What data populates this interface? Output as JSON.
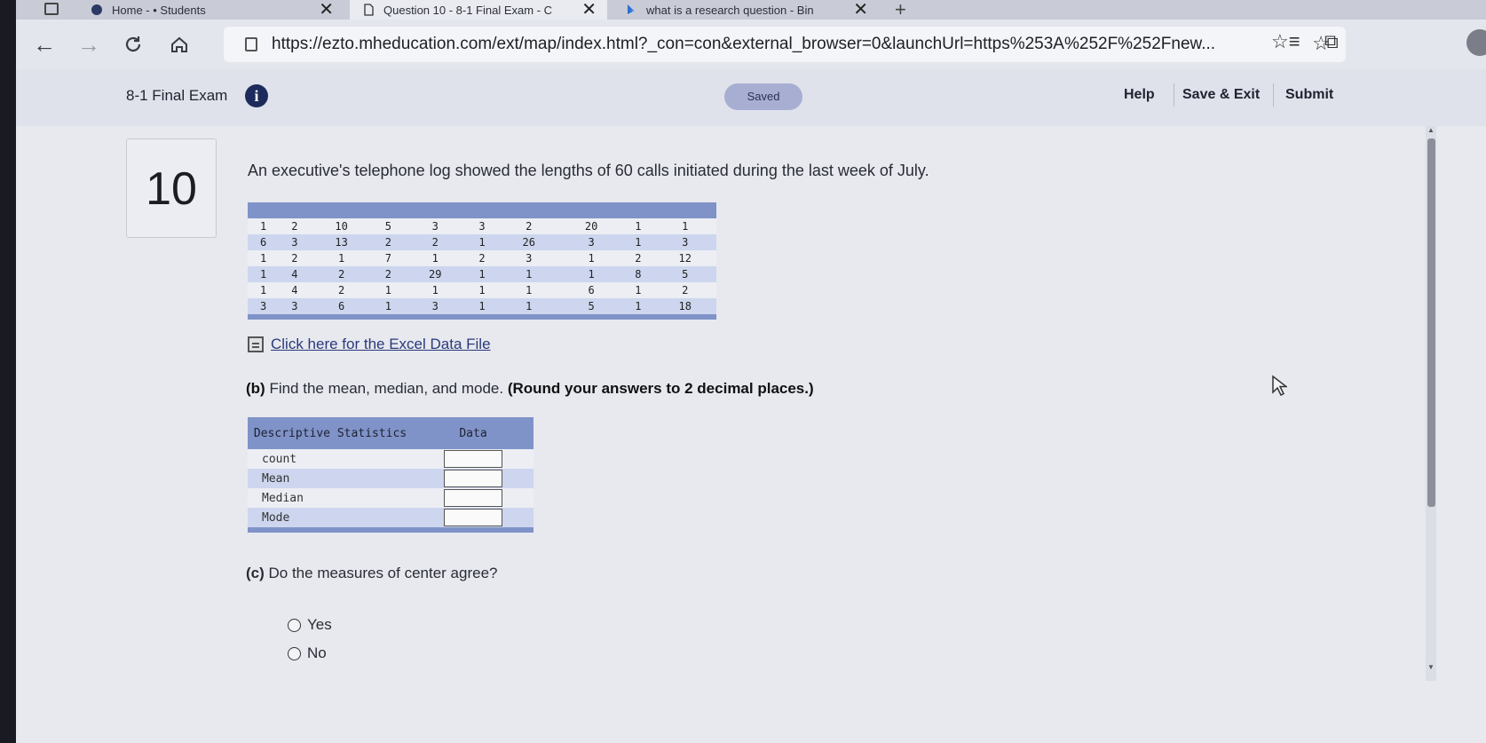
{
  "browser": {
    "tabs": [
      {
        "label": "Home - • Students"
      },
      {
        "label": "Question 10 - 8-1 Final Exam - C",
        "active": true
      },
      {
        "label": "what is a research question - Bin"
      }
    ],
    "url": "https://ezto.mheducation.com/ext/map/index.html?_con=con&external_browser=0&launchUrl=https%253A%252F%252Fnew..."
  },
  "header": {
    "exam_title": "8-1 Final Exam",
    "saved_label": "Saved",
    "help_label": "Help",
    "save_exit_label": "Save & Exit",
    "submit_label": "Submit"
  },
  "question": {
    "number": "10",
    "prompt": "An executive's telephone log showed the lengths of 60 calls initiated during the last week of July.",
    "data_rows": [
      [
        "1",
        "2",
        "10",
        "5",
        "3",
        "3",
        "2",
        "20",
        "1",
        "1"
      ],
      [
        "6",
        "3",
        "13",
        "2",
        "2",
        "1",
        "26",
        "3",
        "1",
        "3"
      ],
      [
        "1",
        "2",
        "1",
        "7",
        "1",
        "2",
        "3",
        "1",
        "2",
        "12"
      ],
      [
        "1",
        "4",
        "2",
        "2",
        "29",
        "1",
        "1",
        "1",
        "8",
        "5"
      ],
      [
        "1",
        "4",
        "2",
        "1",
        "1",
        "1",
        "1",
        "6",
        "1",
        "2"
      ],
      [
        "3",
        "3",
        "6",
        "1",
        "3",
        "1",
        "1",
        "5",
        "1",
        "18"
      ]
    ],
    "excel_link": "Click here for the Excel Data File",
    "part_b_label": "(b)",
    "part_b_text": " Find the mean, median, and mode. ",
    "part_b_bold": "(Round your answers to 2 decimal places.)",
    "stats_table": {
      "header_col1": "Descriptive Statistics",
      "header_col2": "Data",
      "rows": [
        "count",
        "Mean",
        "Median",
        "Mode"
      ]
    },
    "part_c_label": "(c)",
    "part_c_text": " Do the measures of center agree?",
    "options": [
      "Yes",
      "No"
    ]
  }
}
